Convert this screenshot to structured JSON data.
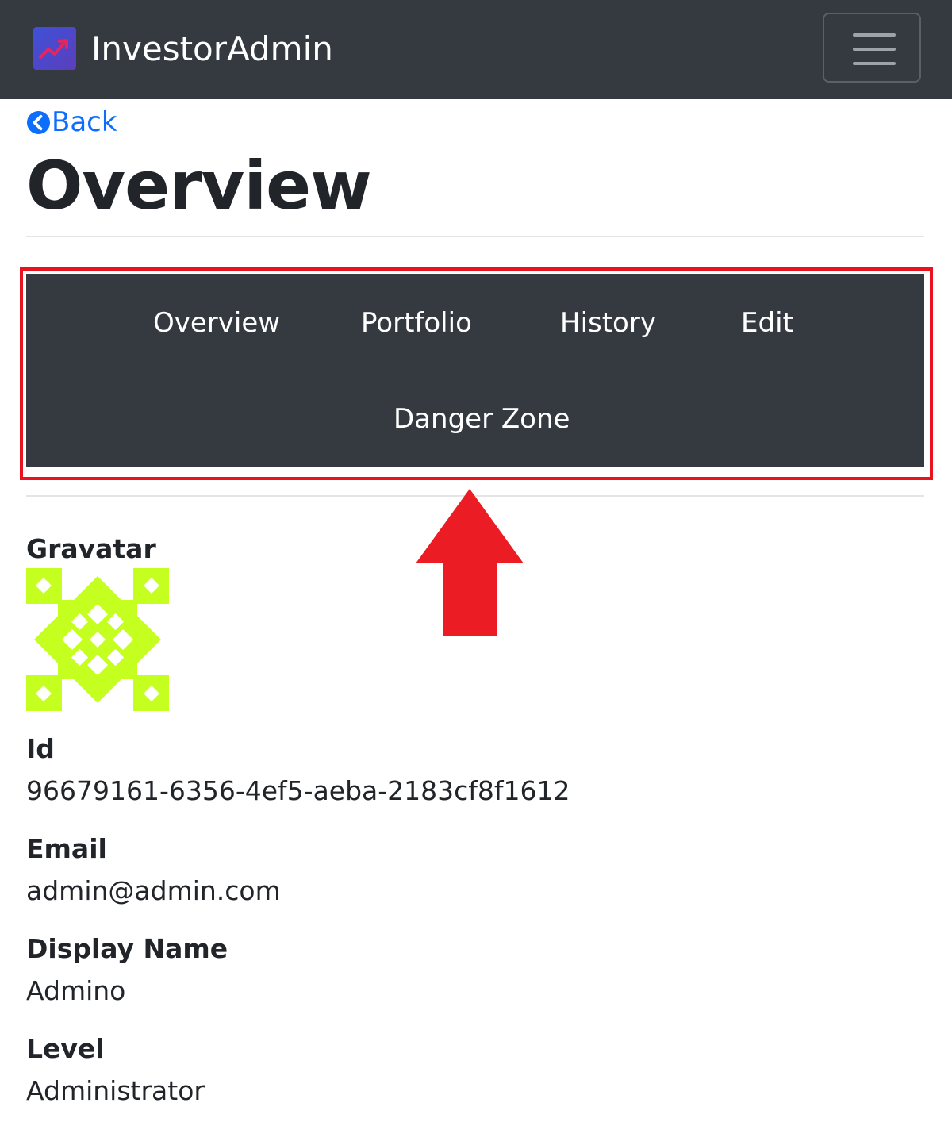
{
  "navbar": {
    "brand_name": "InvestorAdmin",
    "logo_icon": "trending-up-icon",
    "toggler_icon": "hamburger-menu-icon"
  },
  "back": {
    "label": "Back",
    "icon": "chevron-left-circle-icon"
  },
  "page": {
    "title": "Overview"
  },
  "subnav": {
    "items": [
      {
        "label": "Overview"
      },
      {
        "label": "Portfolio"
      },
      {
        "label": "History"
      },
      {
        "label": "Edit"
      },
      {
        "label": "Danger Zone"
      }
    ]
  },
  "details": {
    "gravatar_label": "Gravatar",
    "id_label": "Id",
    "id_value": "96679161-6356-4ef5-aeba-2183cf8f1612",
    "email_label": "Email",
    "email_value": "admin@admin.com",
    "display_name_label": "Display Name",
    "display_name_value": "Admino",
    "level_label": "Level",
    "level_value": "Administrator"
  },
  "colors": {
    "navbar_bg": "#343a40",
    "link": "#0d6efd",
    "highlight": "#e8131f",
    "gravatar_fg": "#c4ff1f"
  }
}
